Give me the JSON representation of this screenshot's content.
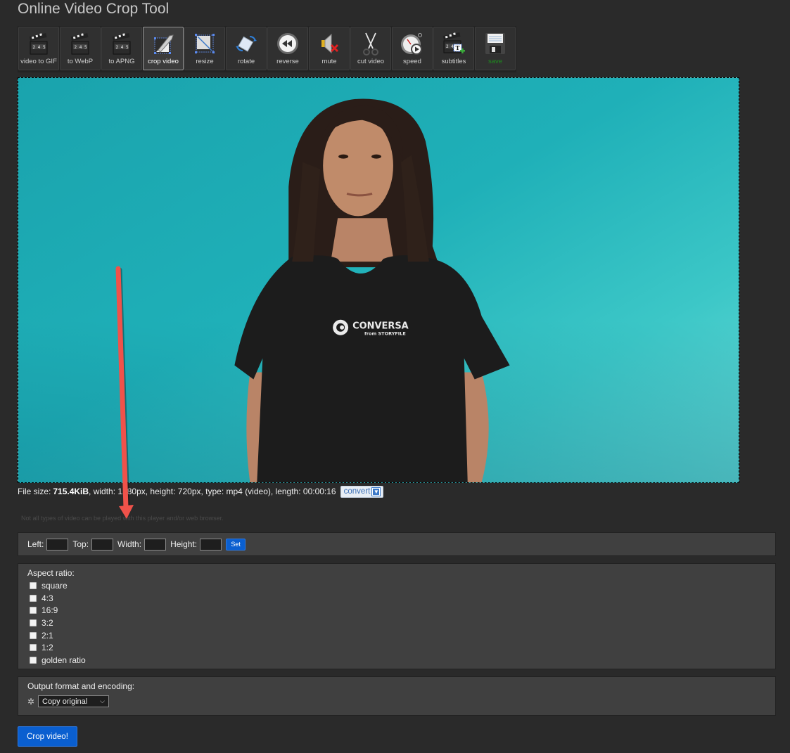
{
  "page": {
    "title": "Online Video Crop Tool"
  },
  "toolbar": {
    "items": [
      {
        "id": "video-to-gif",
        "label": "video to GIF",
        "icon": "clapperboard-icon",
        "active": false
      },
      {
        "id": "to-webp",
        "label": "to WebP",
        "icon": "clapperboard-icon",
        "active": false
      },
      {
        "id": "to-apng",
        "label": "to APNG",
        "icon": "clapperboard-icon",
        "active": false
      },
      {
        "id": "crop-video",
        "label": "crop video",
        "icon": "crop-knife-icon",
        "active": true
      },
      {
        "id": "resize",
        "label": "resize",
        "icon": "resize-icon",
        "active": false
      },
      {
        "id": "rotate",
        "label": "rotate",
        "icon": "rotate-icon",
        "active": false
      },
      {
        "id": "reverse",
        "label": "reverse",
        "icon": "rewind-icon",
        "active": false
      },
      {
        "id": "mute",
        "label": "mute",
        "icon": "speaker-mute-icon",
        "active": false
      },
      {
        "id": "cut-video",
        "label": "cut video",
        "icon": "scissors-icon",
        "active": false
      },
      {
        "id": "speed",
        "label": "speed",
        "icon": "stopwatch-icon",
        "active": false
      },
      {
        "id": "subtitles",
        "label": "subtitles",
        "icon": "subtitles-icon",
        "active": false
      },
      {
        "id": "save",
        "label": "save",
        "icon": "floppy-disk-icon",
        "active": false
      }
    ]
  },
  "video": {
    "shirt_brand": "CONVERSA",
    "shirt_sub": "from STORYFILE"
  },
  "fileinfo": {
    "size_label": "File size:",
    "size_value": "715.4KiB",
    "rest": ", width: 1280px, height: 720px, type: mp4 (video), length: 00:00:16",
    "convert_label": "convert"
  },
  "note": "Not all types of video can be played with this player and/or web browser.",
  "crop_form": {
    "left_label": "Left:",
    "top_label": "Top:",
    "width_label": "Width:",
    "height_label": "Height:",
    "left_value": "",
    "top_value": "",
    "width_value": "",
    "height_value": "",
    "set_label": "Set"
  },
  "aspect_ratio": {
    "header": "Aspect ratio:",
    "options": [
      {
        "label": "square",
        "checked": false
      },
      {
        "label": "4:3",
        "checked": false
      },
      {
        "label": "16:9",
        "checked": false
      },
      {
        "label": "3:2",
        "checked": false
      },
      {
        "label": "2:1",
        "checked": false
      },
      {
        "label": "1:2",
        "checked": false
      },
      {
        "label": "golden ratio",
        "checked": false
      }
    ]
  },
  "output": {
    "header": "Output format and encoding:",
    "selected": "Copy original"
  },
  "crop_button": "Crop video!",
  "colors": {
    "accent_blue": "#0a5fd0",
    "annotation_arrow": "#f0524a",
    "save_label_green": "#1f8a1f"
  }
}
